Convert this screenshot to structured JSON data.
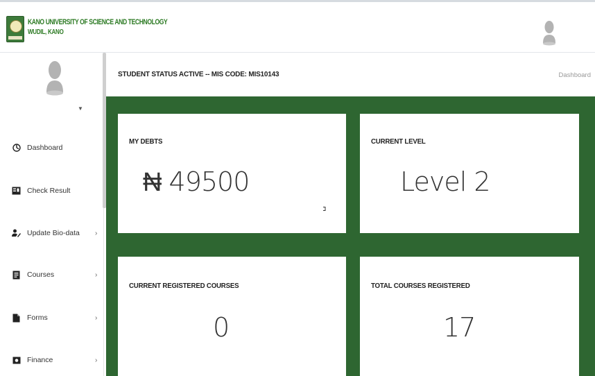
{
  "header": {
    "university_name": "KANO UNIVERSITY OF SCIENCE AND TECHNOLOGY",
    "university_location": "WUDIL, KANO",
    "logo_icon": "university-crest-icon",
    "avatar_icon": "user-avatar-icon"
  },
  "sidebar": {
    "avatar_icon": "user-avatar-icon",
    "user_dropdown_icon": "caret-down-icon",
    "items": [
      {
        "label": "Dashboard",
        "icon": "dashboard-icon",
        "has_submenu": false
      },
      {
        "label": "Check Result",
        "icon": "result-icon",
        "has_submenu": false
      },
      {
        "label": "Update Bio-data",
        "icon": "user-edit-icon",
        "has_submenu": true
      },
      {
        "label": "Courses",
        "icon": "book-icon",
        "has_submenu": true
      },
      {
        "label": "Forms",
        "icon": "document-icon",
        "has_submenu": true
      },
      {
        "label": "Finance",
        "icon": "money-icon",
        "has_submenu": true
      }
    ],
    "chevron": "›"
  },
  "main": {
    "status_text": "STUDENT STATUS ACTIVE -- MIS CODE: MIS10143",
    "breadcrumb": "Dashboard",
    "cards": [
      {
        "title": "MY DEBTS",
        "value": "₦ 49500"
      },
      {
        "title": "CURRENT LEVEL",
        "value": "Level 2"
      },
      {
        "title": "CURRENT REGISTERED COURSES",
        "value": "0"
      },
      {
        "title": "TOTAL COURSES REGISTERED",
        "value": "17"
      }
    ]
  },
  "colors": {
    "brand_green": "#2e6631",
    "logo_text_green": "#2c7a23"
  }
}
